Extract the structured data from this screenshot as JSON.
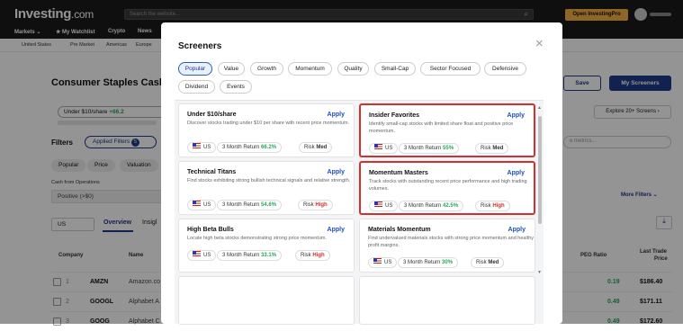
{
  "header": {
    "logo_main": "Investing",
    "logo_suffix": ".com",
    "search_placeholder": "Search the website...",
    "open_pro": "Open InvestingPro"
  },
  "nav": {
    "items": [
      "Markets ⌄",
      "★ My Watchlist",
      "Crypto",
      "News"
    ]
  },
  "subnav": {
    "items": [
      "United States",
      "Pre Market",
      "Americas",
      "Europe"
    ]
  },
  "page": {
    "title": "Consumer Staples Cash I",
    "save": "Save",
    "my_screeners": "My Screeners",
    "chip_under": "Under $10/share",
    "chip_under_pct": "+66.2",
    "explore": "Explore 20+ Screens ›",
    "filters_label": "Filters",
    "applied_filters": "Applied Filters",
    "applied_count": "5",
    "filter_tabs": [
      "Popular",
      "Price",
      "Valuation"
    ],
    "cfo_label": "Cash from Operations",
    "cfo_value": "Positive (>$0)",
    "metrics_placeholder": "e metrics...",
    "more_filters": "More Filters ⌄",
    "country": "US",
    "tab_overview": "Overview",
    "tab_insights": "Insigl",
    "col_company": "Company",
    "col_name": "Name",
    "col_peg": "PEG Ratio",
    "col_last_trade": "Last Trade",
    "col_last_trade_2": "Price",
    "rows": [
      {
        "num": "1",
        "ticker": "AMZN",
        "name": "Amazon.co",
        "peg": "0.19",
        "price": "$186.40"
      },
      {
        "num": "2",
        "ticker": "GOOGL",
        "name": "Alphabet A",
        "peg": "0.49",
        "price": "$171.11"
      },
      {
        "num": "3",
        "ticker": "GOOG",
        "name": "Alphabet C",
        "peg": "0.49",
        "price": "$172.60"
      }
    ]
  },
  "modal": {
    "title": "Screeners",
    "close": "×",
    "categories": [
      "Popular",
      "Value",
      "Growth",
      "Momentum",
      "Quality",
      "Small-Cap",
      "Sector Focused",
      "Defensive",
      "Dividend",
      "Events"
    ],
    "active_category": "Popular",
    "cards": [
      {
        "name": "Under $10/share",
        "apply": "Apply",
        "desc": "Discover stocks trading under $10 per share with recent price momentum.",
        "country": "US",
        "return_label": "3 Month Return",
        "return_value": "66.2%",
        "risk_label": "Risk",
        "risk_value": "Med"
      },
      {
        "name": "Insider Favorites",
        "apply": "Apply",
        "desc": "Identify small-cap stocks with limited share float and positive price momentum.",
        "country": "US",
        "return_label": "3 Month Return",
        "return_value": "55%",
        "risk_label": "Risk",
        "risk_value": "Med"
      },
      {
        "name": "Technical Titans",
        "apply": "Apply",
        "desc": "Find stocks exhibiting strong bullish technical signals and relative strength.",
        "country": "US",
        "return_label": "3 Month Return",
        "return_value": "54.6%",
        "risk_label": "Risk",
        "risk_value": "High"
      },
      {
        "name": "Momentum Masters",
        "apply": "Apply",
        "desc": "Track stocks with outstanding recent price performance and high trading volumes.",
        "country": "US",
        "return_label": "3 Month Return",
        "return_value": "42.5%",
        "risk_label": "Risk",
        "risk_value": "High"
      },
      {
        "name": "High Beta Bulls",
        "apply": "Apply",
        "desc": "Locate high beta stocks demonstrating strong price momentum.",
        "country": "US",
        "return_label": "3 Month Return",
        "return_value": "33.1%",
        "risk_label": "Risk",
        "risk_value": "High"
      },
      {
        "name": "Materials Momentum",
        "apply": "Apply",
        "desc": "Find undervalued materials stocks with strong price momentum and healthy profit margins.",
        "country": "US",
        "return_label": "3 Month Return",
        "return_value": "30%",
        "risk_label": "Risk",
        "risk_value": "Med"
      }
    ]
  },
  "colors": {
    "accent": "#1e3a8a",
    "positive": "#26a65b",
    "risk_high": "#d32f2f",
    "highlight_border": "#d32f2f"
  }
}
